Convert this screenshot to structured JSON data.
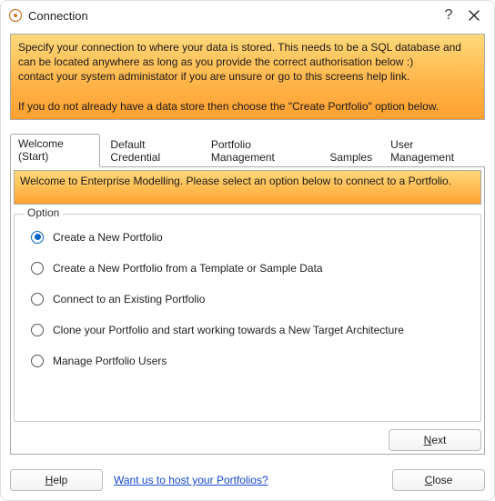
{
  "title": "Connection",
  "info_html": "Specify your connection to where your data is stored. This needs to be a SQL database and can be located anywhere as long as you provide the correct authorisation below :)\ncontact your system administator if you are unsure or go to this screens help link.\n\nIf you do not already have a data store then choose the \"Create Portfolio\" option below.",
  "tabs": [
    {
      "label": "Welcome (Start)",
      "active": true
    },
    {
      "label": "Default Credential",
      "active": false
    },
    {
      "label": "Portfolio Management",
      "active": false
    },
    {
      "label": "Samples",
      "active": false
    },
    {
      "label": "User Management",
      "active": false
    }
  ],
  "welcome_banner": "Welcome to Enterprise Modelling. Please select an option below to connect to a Portfolio.",
  "option_group_label": "Option",
  "options": [
    {
      "label": "Create a New Portfolio",
      "checked": true
    },
    {
      "label": "Create a New Portfolio from a Template or Sample Data",
      "checked": false
    },
    {
      "label": "Connect to an Existing Portfolio",
      "checked": false
    },
    {
      "label": "Clone your Portfolio and start working towards a New Target Architecture",
      "checked": false
    },
    {
      "label": "Manage Portfolio Users",
      "checked": false
    }
  ],
  "buttons": {
    "next": "Next",
    "help": "Help",
    "close": "Close"
  },
  "footer_link": "Want us to host your Portfolios?"
}
